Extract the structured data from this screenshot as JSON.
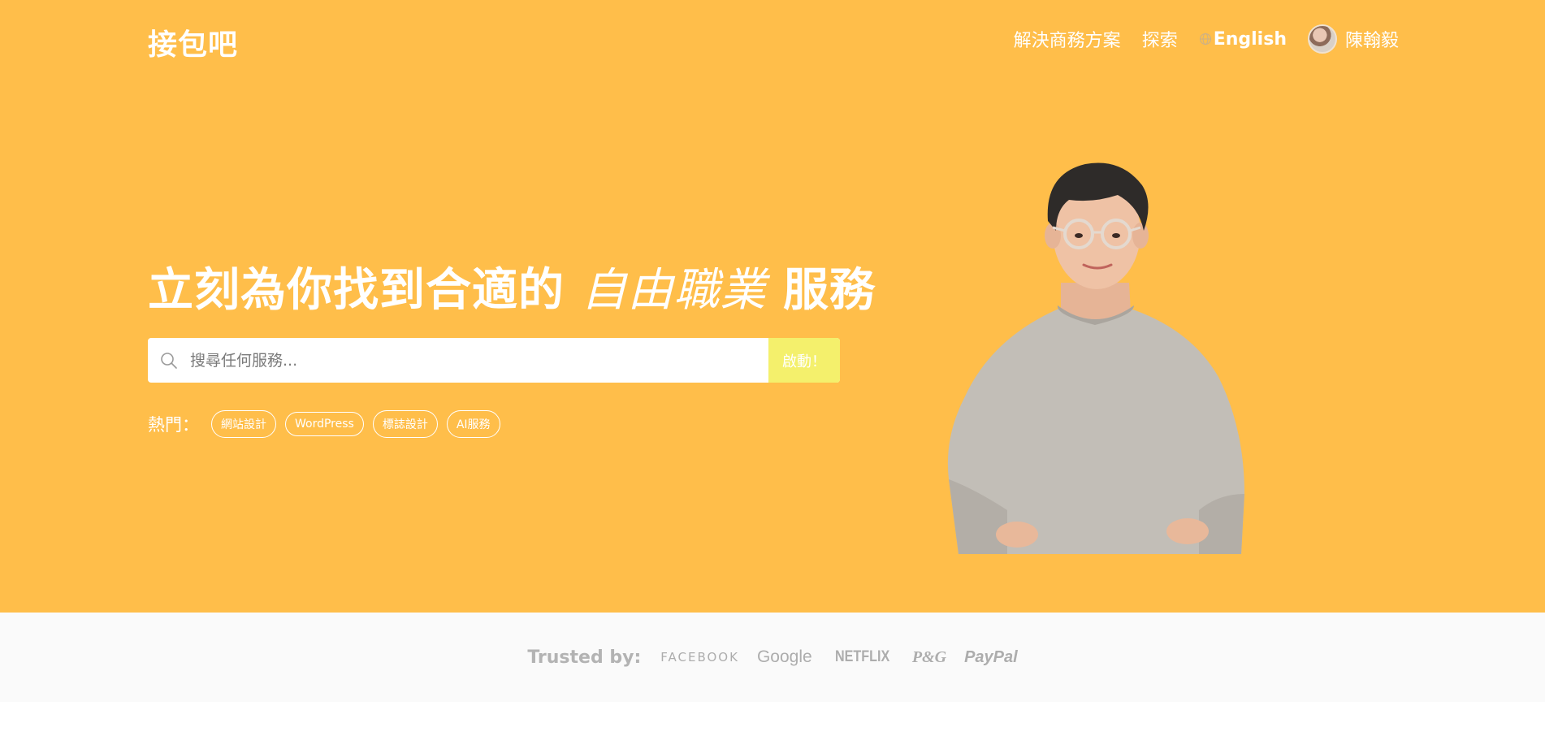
{
  "header": {
    "logo": "接包吧",
    "nav": {
      "business": "解決商務方案",
      "explore": "探索",
      "language": "English",
      "user_name": "陳翰毅"
    }
  },
  "hero": {
    "headline_before": "立刻為你找到合適的 ",
    "headline_accent": "自由職業",
    "headline_after": " 服務",
    "search": {
      "placeholder": "搜尋任何服務...",
      "value": "",
      "button_label": "啟動！"
    },
    "popular": {
      "label": "熱門：",
      "tags": [
        "網站設計",
        "WordPress",
        "標誌設計",
        "AI服務"
      ]
    }
  },
  "trusted": {
    "label": "Trusted by:",
    "brands": [
      "FACEBOOK",
      "Google",
      "NETFLIX",
      "P&G",
      "PayPal"
    ]
  },
  "colors": {
    "hero_bg": "#ffbe4a",
    "search_button": "#f4f06c",
    "trusted_bg": "#fafafa",
    "brand_gray": "#adadad"
  },
  "icons": [
    "globe-icon",
    "search-icon",
    "avatar"
  ]
}
